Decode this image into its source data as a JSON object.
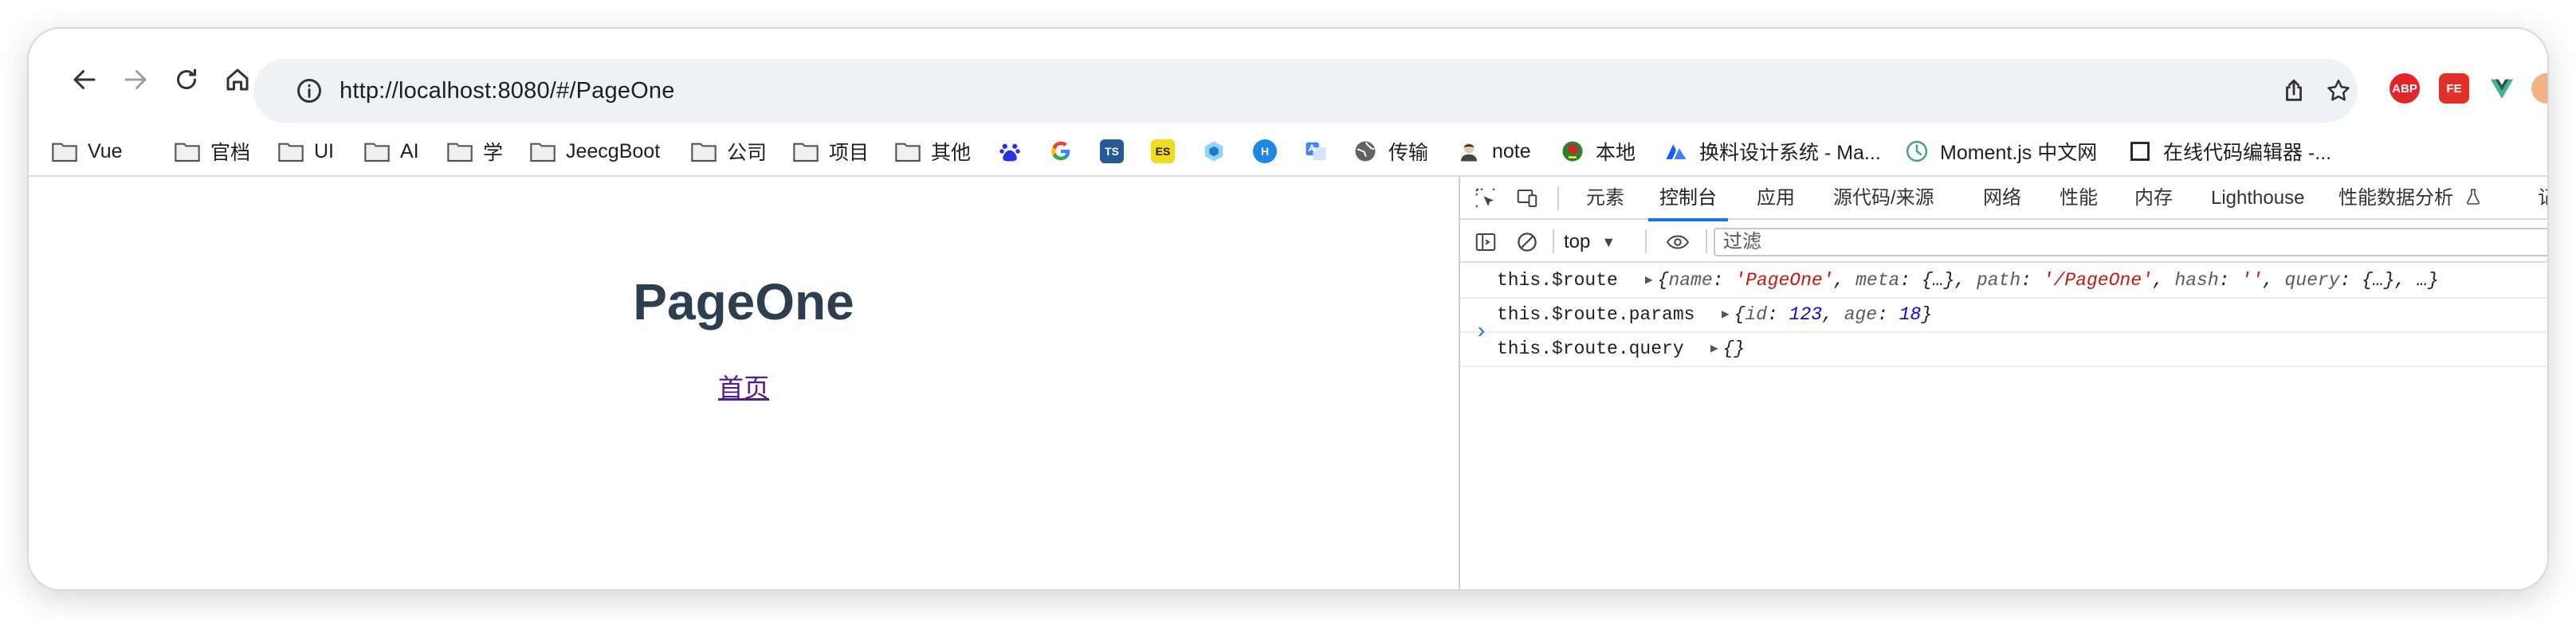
{
  "browser": {
    "url": "http://localhost:8080/#/PageOne",
    "extensions": [
      {
        "icon": "abp-extension-icon",
        "text": "ABP",
        "color": "#e3242b"
      },
      {
        "icon": "fe-extension-icon",
        "text": "FE",
        "color": "#e0322a"
      },
      {
        "icon": "vue-devtools-icon",
        "text": "",
        "color": "#41b883"
      }
    ]
  },
  "bookmarks": [
    {
      "label": "Vue",
      "icon": "folder-icon"
    },
    {
      "label": "官档",
      "icon": "folder-icon"
    },
    {
      "label": "UI",
      "icon": "folder-icon"
    },
    {
      "label": "AI",
      "icon": "folder-icon"
    },
    {
      "label": "学",
      "icon": "folder-icon"
    },
    {
      "label": "JeecgBoot",
      "icon": "folder-icon"
    },
    {
      "label": "公司",
      "icon": "folder-icon"
    },
    {
      "label": "项目",
      "icon": "folder-icon"
    },
    {
      "label": "其他",
      "icon": "folder-icon"
    },
    {
      "label": "",
      "icon": "baidu-icon"
    },
    {
      "label": "",
      "icon": "google-icon"
    },
    {
      "label": "",
      "icon": "typescript-icon",
      "text": "TS"
    },
    {
      "label": "",
      "icon": "es-icon",
      "text": "ES"
    },
    {
      "label": "",
      "icon": "webpack-icon"
    },
    {
      "label": "",
      "icon": "h-icon",
      "text": "H"
    },
    {
      "label": "",
      "icon": "translate-icon"
    },
    {
      "label": "传输",
      "icon": "globe-icon"
    },
    {
      "label": "note",
      "icon": "note-avatar-icon"
    },
    {
      "label": "本地",
      "icon": "local-icon"
    },
    {
      "label": "换料设计系统 - Ma...",
      "icon": "arco-icon"
    },
    {
      "label": "Moment.js 中文网",
      "icon": "clock-icon"
    },
    {
      "label": "在线代码编辑器 -...",
      "icon": "square-icon"
    }
  ],
  "page": {
    "title": "PageOne",
    "link": "首页"
  },
  "devtools": {
    "tabs": [
      "元素",
      "控制台",
      "应用",
      "源代码/来源",
      "网络",
      "性能",
      "内存",
      "Lighthouse",
      "性能数据分析",
      "记"
    ],
    "active_tab": "控制台",
    "context": "top",
    "filter_placeholder": "过滤",
    "console": [
      {
        "expr": "this.$route",
        "preview": [
          {
            "t": "p",
            "v": "{"
          },
          {
            "t": "k",
            "v": "name"
          },
          {
            "t": "p",
            "v": ": "
          },
          {
            "t": "s",
            "v": "'PageOne'"
          },
          {
            "t": "p",
            "v": ", "
          },
          {
            "t": "k",
            "v": "meta"
          },
          {
            "t": "p",
            "v": ": {…}, "
          },
          {
            "t": "k",
            "v": "path"
          },
          {
            "t": "p",
            "v": ": "
          },
          {
            "t": "s",
            "v": "'/PageOne'"
          },
          {
            "t": "p",
            "v": ", "
          },
          {
            "t": "k",
            "v": "hash"
          },
          {
            "t": "p",
            "v": ": "
          },
          {
            "t": "s",
            "v": "''"
          },
          {
            "t": "p",
            "v": ", "
          },
          {
            "t": "k",
            "v": "query"
          },
          {
            "t": "p",
            "v": ": {…}, …}"
          }
        ]
      },
      {
        "expr": "this.$route.params",
        "preview": [
          {
            "t": "p",
            "v": "{"
          },
          {
            "t": "k",
            "v": "id"
          },
          {
            "t": "p",
            "v": ": "
          },
          {
            "t": "n",
            "v": "123"
          },
          {
            "t": "p",
            "v": ", "
          },
          {
            "t": "k",
            "v": "age"
          },
          {
            "t": "p",
            "v": ": "
          },
          {
            "t": "n",
            "v": "18"
          },
          {
            "t": "p",
            "v": "}"
          }
        ]
      },
      {
        "expr": "this.$route.query",
        "preview": [
          {
            "t": "p",
            "v": "{}"
          }
        ]
      }
    ],
    "prompt": "›"
  }
}
